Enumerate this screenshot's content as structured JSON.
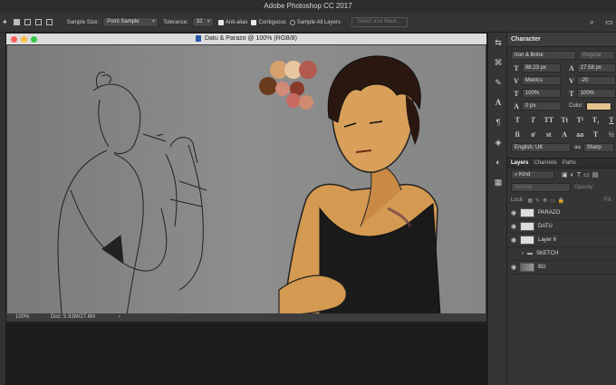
{
  "app": {
    "title": "Adobe Photoshop CC 2017"
  },
  "options": {
    "sample_size_label": "Sample Size:",
    "sample_size_value": "Point Sample",
    "tolerance_label": "Tolerance:",
    "tolerance_value": "32",
    "anti_alias": "Anti-alias",
    "contiguous": "Contiguous",
    "sample_all_layers": "Sample All Layers",
    "select_mask": "Select and Mask..."
  },
  "document": {
    "title": "Datu & Parazo @ 100% (RGB/8)",
    "zoom": "100%",
    "doc_size": "Doc: 5.93M/27.6M",
    "swatches": [
      "#6a3a1c",
      "#d5a16c",
      "#e8c6a0",
      "#b35a50",
      "#d08a76",
      "#8a3a2a",
      "#c86a60",
      "#cf8b6f"
    ]
  },
  "character": {
    "header": "Character",
    "font_family": "Iron & Brine",
    "font_style": "Regular",
    "font_size": "98.23 px",
    "leading": "27.58 px",
    "kerning": "Metrics",
    "tracking": "-20",
    "vscale": "100%",
    "hscale": "100%",
    "baseline": "0 px",
    "color_label": "Color:",
    "color_value": "#e3c28d",
    "language": "English: UK",
    "antialias": "Sharp"
  },
  "layers": {
    "tabs": [
      "Layers",
      "Channels",
      "Paths"
    ],
    "kind": "Kind",
    "blend": "Normal",
    "opacity_label": "Opacity:",
    "lock_label": "Lock:",
    "fill_label": "Fill:",
    "items": [
      {
        "name": "PARAZO",
        "visible": true
      },
      {
        "name": "DATU",
        "visible": true
      },
      {
        "name": "Layer 6",
        "visible": true
      },
      {
        "name": "SKETCH",
        "visible": false,
        "folder": true
      },
      {
        "name": "BG",
        "visible": true
      }
    ]
  }
}
